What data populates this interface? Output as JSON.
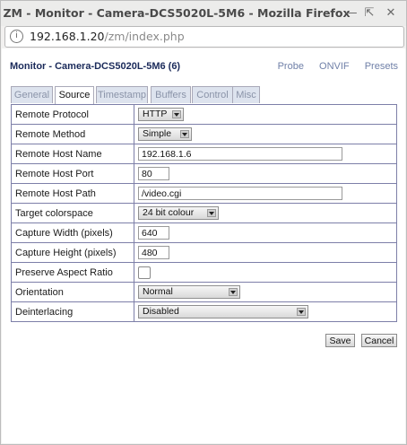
{
  "window": {
    "title": "ZM - Monitor - Camera-DCS5020L-5M6 - Mozilla Firefox"
  },
  "url": {
    "host": "192.168.1.20",
    "path": "/zm/index.php"
  },
  "page": {
    "heading": "Monitor - Camera-DCS5020L-5M6 (6)",
    "links": [
      "Probe",
      "ONVIF",
      "Presets"
    ]
  },
  "tabs": [
    {
      "label": "General"
    },
    {
      "label": "Source"
    },
    {
      "label": "Timestamp"
    },
    {
      "label": "Buffers"
    },
    {
      "label": "Control"
    },
    {
      "label": "Misc"
    }
  ],
  "active_tab": "Source",
  "fields": {
    "remote_protocol": {
      "label": "Remote Protocol",
      "value": "HTTP"
    },
    "remote_method": {
      "label": "Remote Method",
      "value": "Simple"
    },
    "remote_host_name": {
      "label": "Remote Host Name",
      "value": "192.168.1.6"
    },
    "remote_host_port": {
      "label": "Remote Host Port",
      "value": "80"
    },
    "remote_host_path": {
      "label": "Remote Host Path",
      "value": "/video.cgi"
    },
    "target_colorspace": {
      "label": "Target colorspace",
      "value": "24 bit colour"
    },
    "capture_width": {
      "label": "Capture Width (pixels)",
      "value": "640"
    },
    "capture_height": {
      "label": "Capture Height (pixels)",
      "value": "480"
    },
    "preserve_aspect": {
      "label": "Preserve Aspect Ratio",
      "checked": false
    },
    "orientation": {
      "label": "Orientation",
      "value": "Normal"
    },
    "deinterlacing": {
      "label": "Deinterlacing",
      "value": "Disabled"
    }
  },
  "buttons": {
    "save": "Save",
    "cancel": "Cancel"
  },
  "colors": {
    "heading": "#1a2a5a",
    "link": "#7080a8",
    "table_border": "#7d7fa8",
    "tab_bg": "#dde3ee"
  }
}
